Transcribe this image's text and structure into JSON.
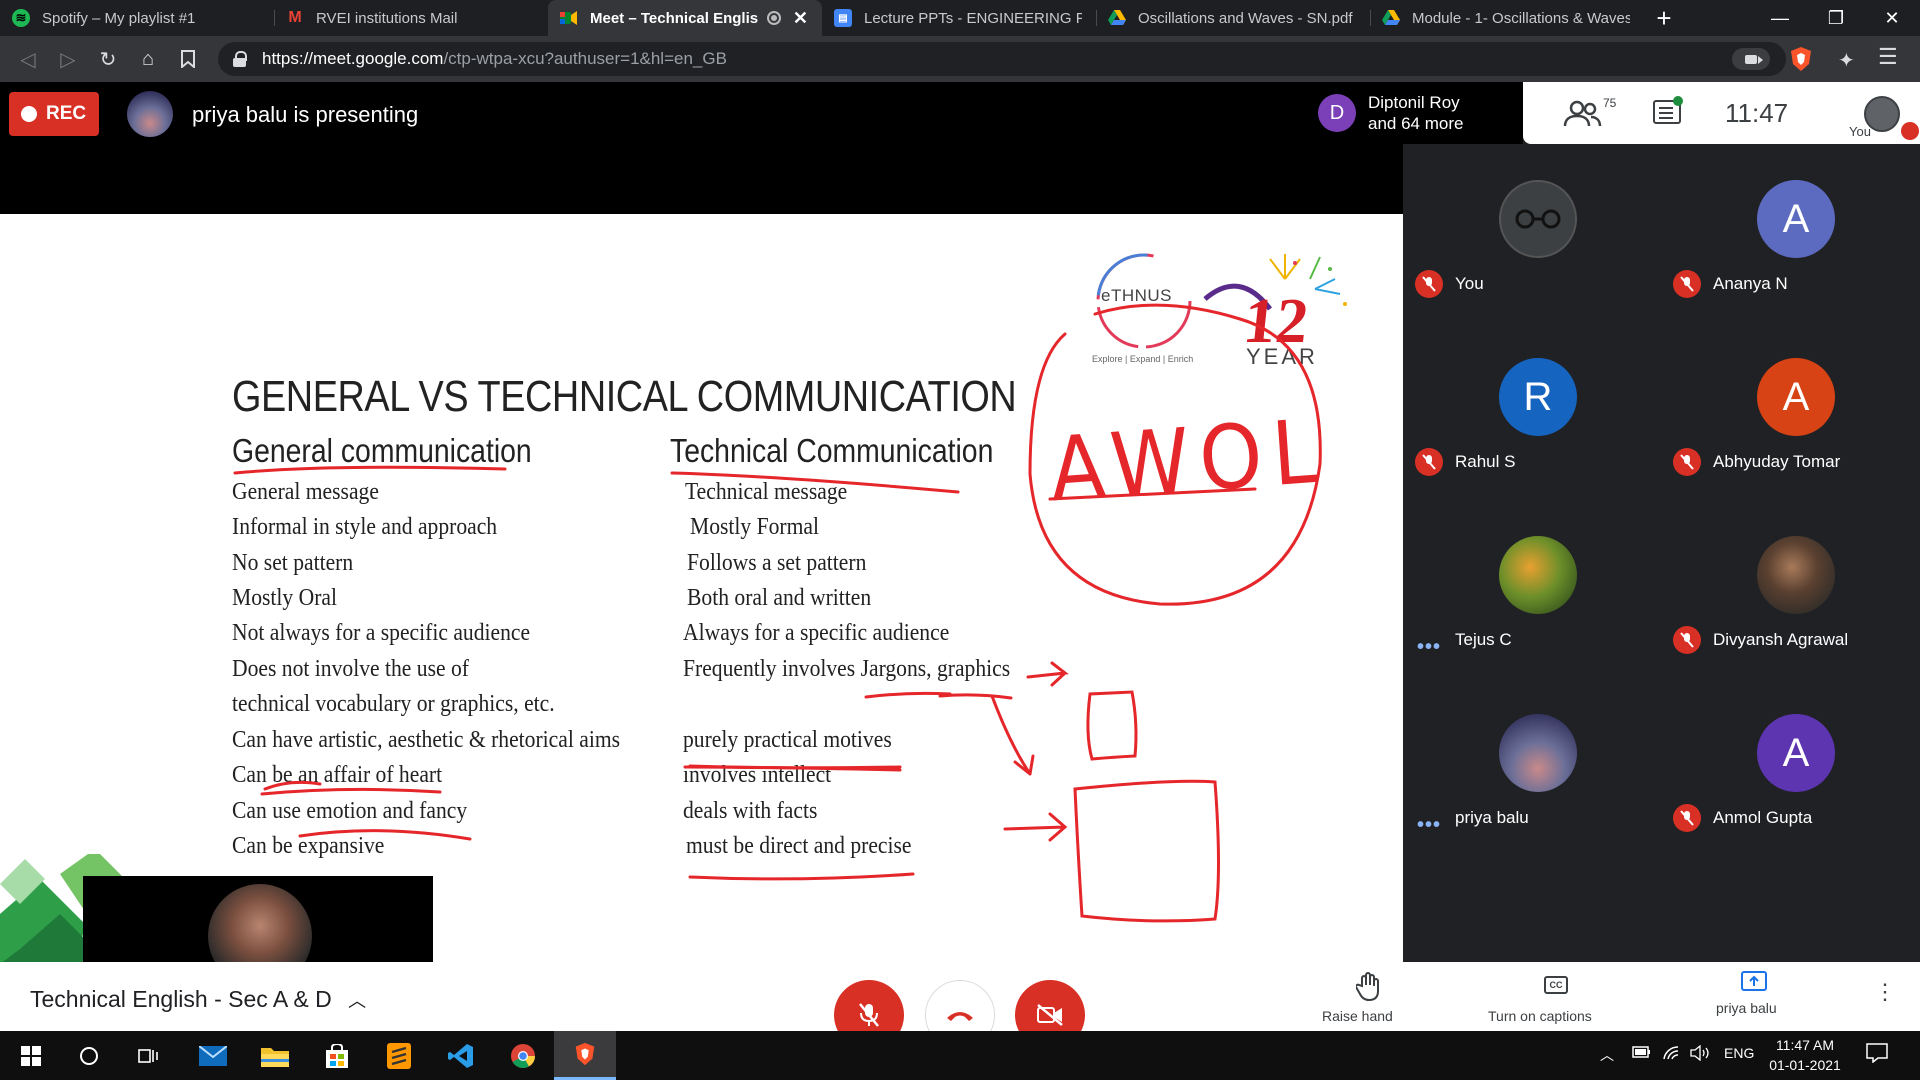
{
  "browser": {
    "tabs": [
      {
        "title": "Spotify – My playlist #1",
        "icon": "spotify-icon"
      },
      {
        "title": "RVEI institutions Mail",
        "icon": "gmail-icon"
      },
      {
        "title": "Meet – Technical English ·",
        "icon": "meet-icon",
        "active": true
      },
      {
        "title": "Lecture PPTs - ENGINEERING PHYS",
        "icon": "docs-icon"
      },
      {
        "title": "Oscillations and Waves - SN.pdf",
        "icon": "drive-icon"
      },
      {
        "title": "Module - 1- Oscillations & Waves",
        "icon": "drive-icon"
      }
    ],
    "url_host": "https://meet.google.com",
    "url_path": "/ctp-wtpa-xcu?authuser=1&hl=en_GB"
  },
  "meet": {
    "rec_label": "REC",
    "presenting_text": "priya balu is presenting",
    "people_chip": {
      "initial": "D",
      "line1": "Diptonil Roy",
      "line2": "and 64 more"
    },
    "participant_count": "75",
    "time": "11:47",
    "you_label": "You",
    "meeting_title": "Technical English - Sec A & D",
    "raise_hand_label": "Raise hand",
    "captions_label": "Turn on captions",
    "presenter_label": "priya balu"
  },
  "slide": {
    "title": "GENERAL VS TECHNICAL COMMUNICATION",
    "left_heading": "General communication",
    "right_heading": "Technical Communication",
    "left_items": [
      "General message",
      "Informal in style and approach",
      "No set pattern",
      "Mostly Oral",
      "Not always for a specific audience",
      "Does not involve the use of",
      "technical vocabulary or graphics, etc.",
      "Can have artistic, aesthetic & rhetorical aims",
      "Can be an affair of heart",
      "Can use emotion and fancy",
      "Can be expansive"
    ],
    "right_items": [
      "Technical message",
      "Mostly Formal",
      "Follows a set pattern",
      "Both oral and written",
      "Always for a specific audience",
      "Frequently involves Jargons, graphics",
      "purely practical motives",
      "involves intellect",
      "deals with facts",
      "must be direct and precise"
    ],
    "handwritten": "AWOL",
    "logo_text": "eTHNUS",
    "logo_tagline": "Explore | Expand | Enrich",
    "anniv_number": "12",
    "anniv_word": "YEAR"
  },
  "participants": [
    {
      "name": "You",
      "initial": "",
      "color": "#3c4043",
      "status": "muted"
    },
    {
      "name": "Ananya N",
      "initial": "A",
      "color": "#5c6bc0",
      "status": "muted"
    },
    {
      "name": "Rahul S",
      "initial": "R",
      "color": "#1565c0",
      "status": "muted"
    },
    {
      "name": "Abhyuday Tomar",
      "initial": "A",
      "color": "#d84315",
      "status": "muted"
    },
    {
      "name": "Tejus C",
      "initial": "",
      "color": "#5d7a2a",
      "status": "speaking"
    },
    {
      "name": "Divyansh Agrawal",
      "initial": "",
      "color": "#4e4036",
      "status": "muted"
    },
    {
      "name": "priya balu",
      "initial": "",
      "color": "#4a4f7a",
      "status": "speaking"
    },
    {
      "name": "Anmol Gupta",
      "initial": "A",
      "color": "#5e35b1",
      "status": "muted"
    }
  ],
  "taskbar": {
    "lang": "ENG",
    "time": "11:47 AM",
    "date": "01-01-2021"
  }
}
